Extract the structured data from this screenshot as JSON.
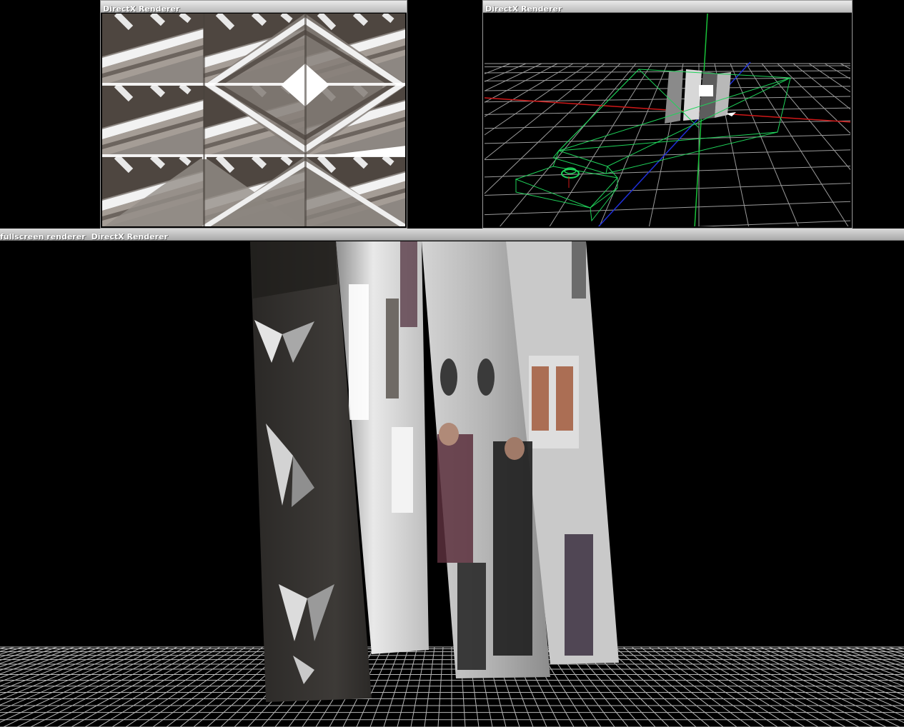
{
  "windows": {
    "texture_preview": {
      "title": "DirectX Renderer"
    },
    "scene_view": {
      "title": "DirectX Renderer"
    },
    "fullscreen": {
      "title_prefix": "fullscreen renderer",
      "title": "DirectX Renderer"
    }
  },
  "colors": {
    "grid": "#cfcfcf",
    "frustum": "#1fd35a",
    "axis_x": "#d01818",
    "axis_y": "#19c23a",
    "axis_z": "#1f2fd8",
    "titlebar_text": "#ffffff"
  },
  "icons": {
    "light_marker": "light-icon",
    "camera_marker": "camera-icon"
  }
}
